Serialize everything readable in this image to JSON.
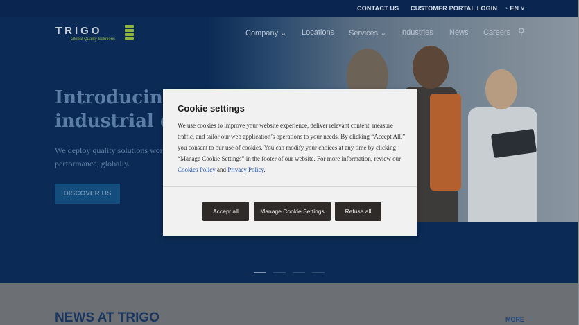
{
  "utility_bar": {
    "contact": "CONTACT US",
    "portal": "CUSTOMER PORTAL LOGIN",
    "language": "EN"
  },
  "logo": {
    "word": "TRIGO",
    "tagline": "Global Quality Solutions"
  },
  "nav": {
    "company": "Company",
    "locations": "Locations",
    "services": "Services",
    "industries": "Industries",
    "news": "News",
    "careers": "Careers"
  },
  "hero": {
    "title": "Introducing the future of industrial quality",
    "subtitle": "We deploy quality solutions worldwide to guarantee your performance, globally.",
    "cta": "DISCOVER US"
  },
  "lower": {
    "news_title": "NEWS AT TRIGO",
    "more": "MORE"
  },
  "cookie_dialog": {
    "title": "Cookie settings",
    "body_text": "We use cookies to improve your website experience, deliver relevant content, measure traffic, and tailor our web application’s operations to your needs. By clicking “Accept All,” you consent to our use of cookies. You can modify your choices at any time by clicking “Manage Cookie Settings” in the footer of our website.  For more information, review our",
    "cookies_policy": "Cookies Policy",
    "and": "and",
    "privacy_policy": "Privacy Policy",
    "period": ".",
    "accept": "Accept all",
    "manage": "Manage Cookie Settings",
    "refuse": "Refuse all"
  },
  "icons": {
    "search": "search-icon",
    "globe": "globe-icon",
    "chevron": "chevron-down-icon"
  },
  "colors": {
    "hero_bg": "#0b2a55",
    "accent_green": "#8fb43c",
    "button_dark": "#2e2b28",
    "link_blue": "#1f4ea6"
  }
}
